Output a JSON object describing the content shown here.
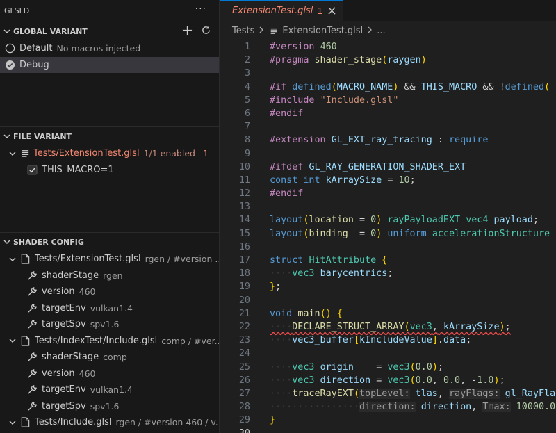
{
  "sidebar": {
    "title": "GLSLD",
    "more": "···",
    "global_variant": {
      "header": "GLOBAL VARIANT",
      "items": [
        {
          "label": "Default",
          "desc": "No macros injected"
        },
        {
          "label": "Debug",
          "desc": ""
        }
      ]
    },
    "file_variant": {
      "header": "FILE VARIANT",
      "file": {
        "label": "Tests/ExtensionTest.glsl",
        "desc": "1/1 enabled",
        "badge": "1"
      },
      "macros": [
        {
          "label": "THIS_MACRO=1"
        }
      ]
    },
    "shader_config": {
      "header": "SHADER CONFIG",
      "files": [
        {
          "label": "Tests/ExtensionTest.glsl",
          "desc": "rgen / #version ...",
          "children": [
            {
              "label": "shaderStage",
              "value": "rgen"
            },
            {
              "label": "version",
              "value": "460"
            },
            {
              "label": "targetEnv",
              "value": "vulkan1.4"
            },
            {
              "label": "targetSpv",
              "value": "spv1.6"
            }
          ]
        },
        {
          "label": "Tests/IndexTest/Include.glsl",
          "desc": "comp / #ver...",
          "children": [
            {
              "label": "shaderStage",
              "value": "comp"
            },
            {
              "label": "version",
              "value": "460"
            },
            {
              "label": "targetEnv",
              "value": "vulkan1.4"
            },
            {
              "label": "targetSpv",
              "value": "spv1.6"
            }
          ]
        },
        {
          "label": "Tests/Include.glsl",
          "desc": "rgen / #version 460 / v...",
          "children": []
        }
      ]
    }
  },
  "editor": {
    "tab": {
      "name": "ExtensionTest.glsl",
      "problems": "1"
    },
    "breadcrumb": {
      "folder": "Tests",
      "file": "ExtensionTest.glsl",
      "more": "..."
    },
    "line_numbers": [
      "1",
      "2",
      "3",
      "4",
      "5",
      "6",
      "7",
      "8",
      "9",
      "10",
      "11",
      "12",
      "13",
      "14",
      "15",
      "16",
      "17",
      "18",
      "19",
      "20",
      "21",
      "22",
      "23",
      "24",
      "25",
      "26",
      "27",
      "28",
      "29",
      "30"
    ],
    "code": [
      "#version 460",
      "#pragma shader_stage(raygen)",
      "",
      "#if defined(MACRO_NAME) && THIS_MACRO && !defined(",
      "#include \"Include.glsl\"",
      "#endif",
      "",
      "#extension GL_EXT_ray_tracing : require",
      "",
      "#ifdef GL_RAY_GENERATION_SHADER_EXT",
      "const int kArraySize = 10;",
      "#endif",
      "",
      "layout(location = 0) rayPayloadEXT vec4 payload;",
      "layout(binding  = 0) uniform accelerationStructure",
      "",
      "struct HitAttribute {",
      "    vec3 barycentrics;",
      "};",
      "",
      "void main() {",
      "    DECLARE_STRUCT_ARRAY(vec3, kArraySize);",
      "    vec3_buffer[kIncludeValue].data;",
      "",
      "    vec3 origin    = vec3(0.0);",
      "    vec3 direction = vec3(0.0, 0.0, -1.0);",
      "    traceRayEXT(topLevel: tlas, rayFlags: gl_RayFlag",
      "                direction: direction, Tmax: 10000.0",
      "}",
      ""
    ]
  },
  "colors": {
    "accent": "#0078d4",
    "error": "#f48771",
    "keyword": "#569cd6",
    "preprocessor": "#c586c0",
    "function": "#dcdcaa",
    "type": "#4ec9b0",
    "string": "#ce9178",
    "number": "#b5cea8",
    "variable": "#9cdcfe"
  }
}
